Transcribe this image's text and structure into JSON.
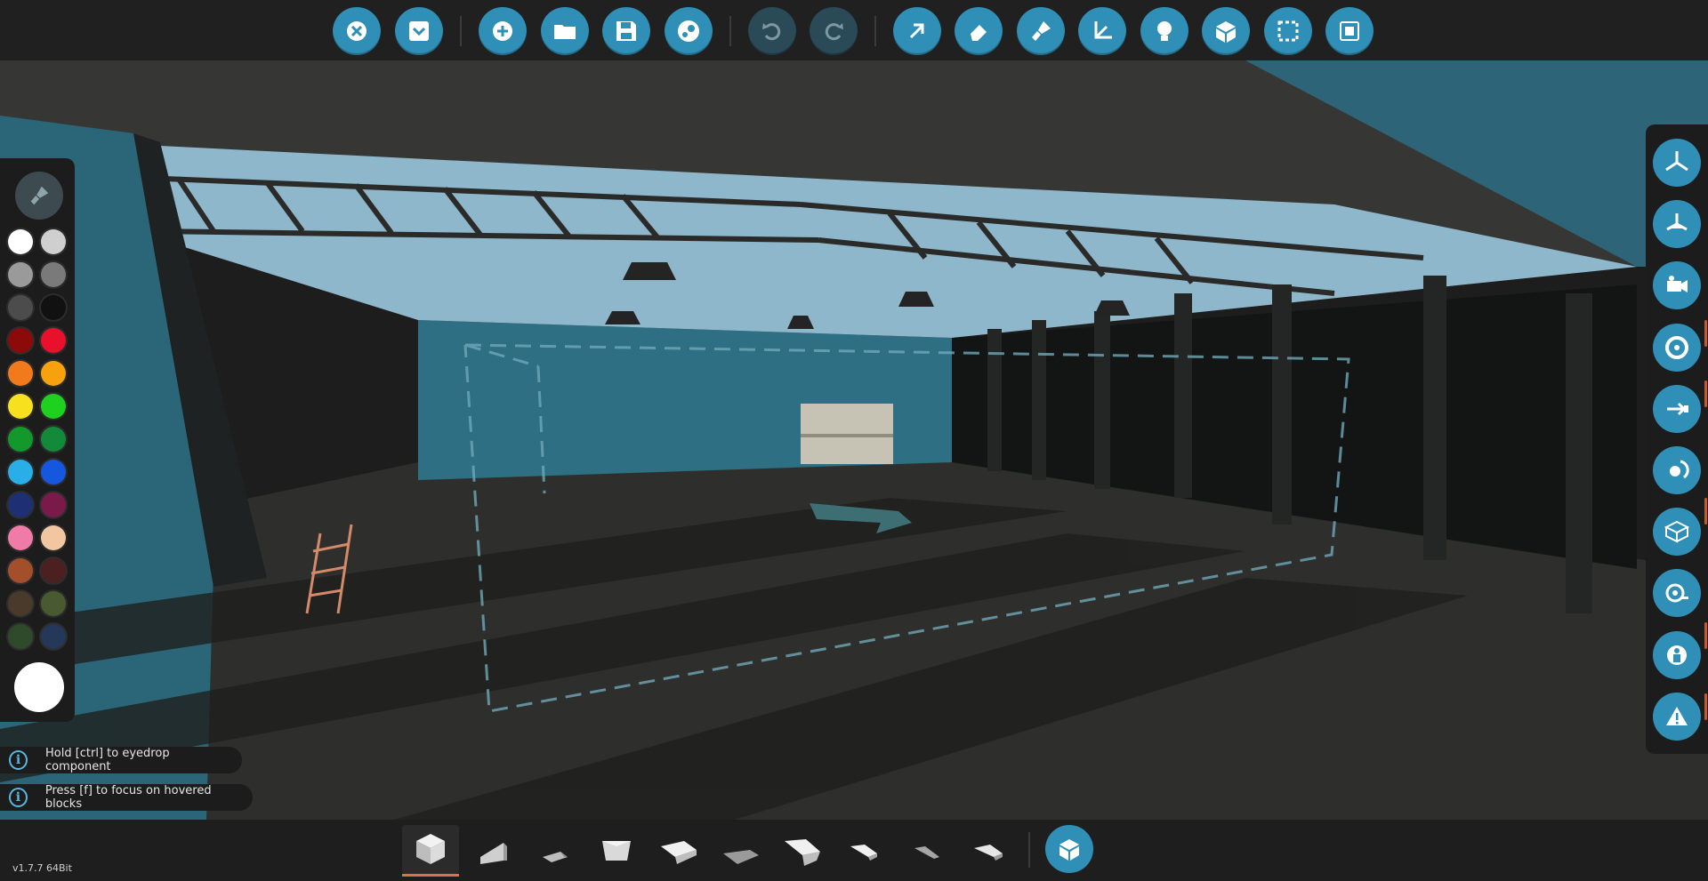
{
  "top_toolbar": {
    "buttons": [
      {
        "icon": "close-icon",
        "enabled": true
      },
      {
        "icon": "collapse-menu-icon",
        "enabled": true
      },
      {
        "icon": "new-vehicle-icon",
        "enabled": true
      },
      {
        "icon": "open-folder-icon",
        "enabled": true
      },
      {
        "icon": "save-icon",
        "enabled": true
      },
      {
        "icon": "steam-workshop-icon",
        "enabled": true
      },
      {
        "icon": "undo-icon",
        "enabled": false
      },
      {
        "icon": "redo-icon",
        "enabled": false
      },
      {
        "icon": "select-cursor-icon",
        "enabled": true
      },
      {
        "icon": "eraser-icon",
        "enabled": true
      },
      {
        "icon": "paint-brush-icon",
        "enabled": true
      },
      {
        "icon": "move-axes-icon",
        "enabled": true
      },
      {
        "icon": "lightbulb-icon",
        "enabled": true
      },
      {
        "icon": "blocks-icon",
        "enabled": true
      },
      {
        "icon": "selection-box-icon",
        "enabled": true
      },
      {
        "icon": "microprocessor-icon",
        "enabled": true
      }
    ]
  },
  "palette": {
    "tool_icon": "paint-brush-icon",
    "swatches": [
      "#ffffff",
      "#cfcfcf",
      "#9a9a9a",
      "#7a7a7a",
      "#4c4c4c",
      "#111111",
      "#8c0a0a",
      "#e8102a",
      "#f07a1c",
      "#f7a10d",
      "#f7e01e",
      "#1fd11f",
      "#13992b",
      "#128a3a",
      "#2aaee8",
      "#1657e0",
      "#1f2f73",
      "#7a1a4a",
      "#f07aa8",
      "#f3c6a2",
      "#a44f2c",
      "#4c2020",
      "#4a3a2c",
      "#4a5a30",
      "#2f4a2a",
      "#25385a"
    ],
    "selected_color": "#ffffff"
  },
  "right_bar": {
    "buttons": [
      "propeller-icon",
      "rotor-icon",
      "camera-icon",
      "wheel-icon",
      "connector-arrow-icon",
      "orbit-icon",
      "box-icon",
      "tape-measure-icon",
      "seat-icon",
      "warning-icon"
    ]
  },
  "hints": [
    {
      "icon_glyph": "i",
      "text": "Hold [ctrl] to eyedrop component"
    },
    {
      "icon_glyph": "i",
      "text": "Press [f] to focus on hovered blocks"
    }
  ],
  "bottom_bar": {
    "blocks": [
      "cube-block-icon",
      "wedge-block-icon",
      "pyramid-block-icon",
      "inverted-wedge-block-icon",
      "large-wedge-block-icon",
      "flat-wedge-block-icon",
      "long-wedge-block-icon",
      "slope-block-icon",
      "thin-slope-block-icon",
      "narrow-slope-block-icon"
    ],
    "active_index": 0,
    "main_button_icon": "blocks-icon"
  },
  "version": "v1.7.7 64Bit",
  "colors": {
    "accent": "#2f8fb6",
    "accent_disabled": "#2a4a58",
    "panel": "#1b1c1b",
    "active_underline": "#d7744a"
  }
}
